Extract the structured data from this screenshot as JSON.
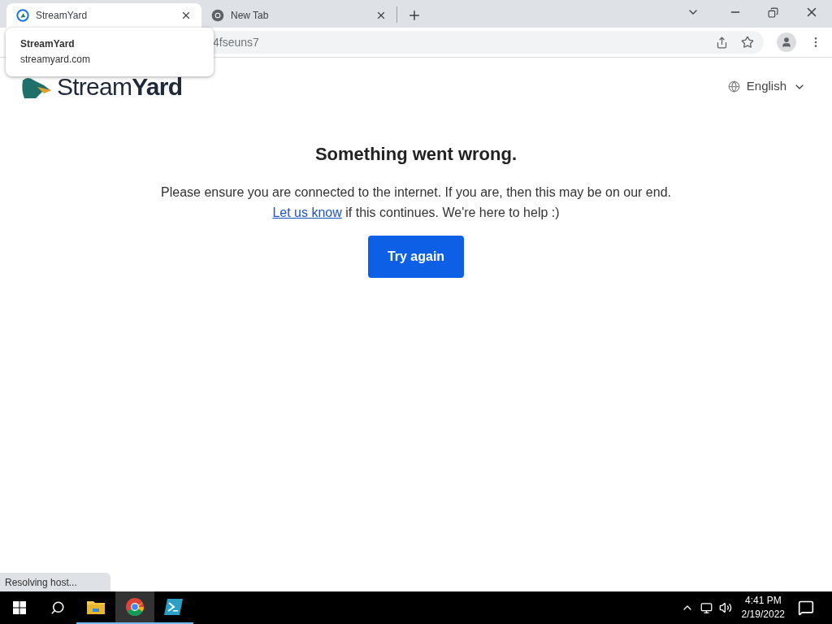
{
  "tabs": [
    {
      "title": "StreamYard",
      "selected": true,
      "kind": "streamyard"
    },
    {
      "title": "New Tab",
      "selected": false,
      "kind": "chrome"
    }
  ],
  "address_bar": {
    "value": "4fseuns7"
  },
  "tab_tooltip": {
    "title": "StreamYard",
    "url": "streamyard.com"
  },
  "page": {
    "logo": "Stream**Yard**",
    "language": "English",
    "heading": "Something went wrong.",
    "message": "Please ensure you are connected to the internet. If you are, then this may be on our end.",
    "link": "Let us know",
    "message_end": "if this continues. We're here to help :)",
    "button": "Try again"
  },
  "status": "Resolving host...",
  "taskbar": {
    "apps": [
      {
        "kind": "explorer",
        "selected": false
      },
      {
        "kind": "chrome",
        "selected": true
      },
      {
        "kind": "powershell",
        "selected": false
      }
    ],
    "time": "4:41 PM",
    "date": "2/19/2022"
  }
}
